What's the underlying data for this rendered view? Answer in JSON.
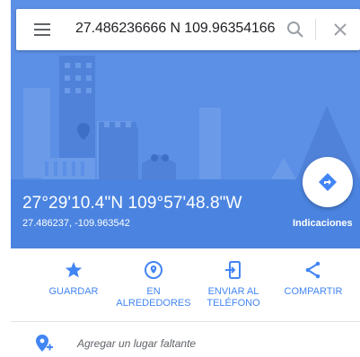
{
  "search": {
    "query": "27.486236666 N 109.963541666",
    "menu_icon": "menu-icon",
    "search_icon": "search-icon",
    "close_icon": "close-icon"
  },
  "place": {
    "dms": "27°29'10.4\"N 109°57'48.8\"W",
    "decimal": "27.486237, -109.963542"
  },
  "directions": {
    "label": "Indicaciones",
    "icon": "directions-icon"
  },
  "actions": [
    {
      "label": "GUARDAR",
      "icon": "star-icon"
    },
    {
      "label": "EN\nALREDEDORES",
      "icon": "nearby-icon"
    },
    {
      "label": "ENVIAR AL\nTELÉFONO",
      "icon": "send-to-phone-icon"
    },
    {
      "label": "COMPARTIR",
      "icon": "share-icon"
    }
  ],
  "add_place": {
    "label": "Agregar un lugar faltante",
    "icon": "add-location-icon"
  },
  "colors": {
    "header_blue": "#5c8fe6",
    "accent_blue": "#4285f4",
    "text_gray": "#5f6368"
  }
}
